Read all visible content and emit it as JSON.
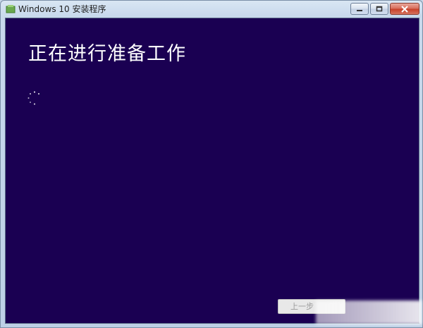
{
  "window": {
    "title": "Windows 10 安装程序",
    "caption_buttons": [
      "minimize-icon",
      "restore-icon",
      "close-icon"
    ],
    "colors": {
      "client_background": "#1a0052",
      "heading_text": "#ffffff"
    }
  },
  "main": {
    "heading": "正在进行准备工作",
    "status": "loading-spinner"
  },
  "footer": {
    "back_label": "上一步"
  }
}
